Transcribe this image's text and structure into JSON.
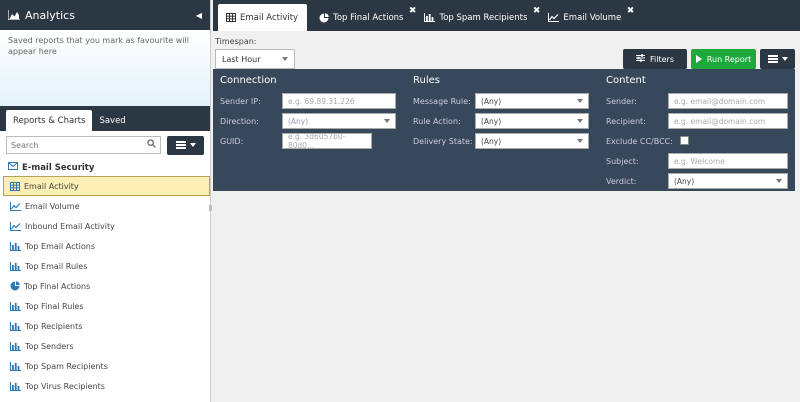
{
  "sidebar": {
    "title": "Analytics",
    "favourites_note": "Saved reports that you mark as favourite will appear here",
    "tabs": [
      {
        "label": "Reports & Charts",
        "active": true
      },
      {
        "label": "Saved",
        "active": false
      }
    ],
    "search_placeholder": "Search",
    "section_title": "E-mail Security",
    "items": [
      {
        "label": "Email Activity",
        "icon": "table-icon",
        "active": true
      },
      {
        "label": "Email Volume",
        "icon": "line-chart-icon"
      },
      {
        "label": "Inbound Email Activity",
        "icon": "line-chart-icon"
      },
      {
        "label": "Top Email Actions",
        "icon": "bar-chart-icon"
      },
      {
        "label": "Top Email Rules",
        "icon": "bar-chart-icon"
      },
      {
        "label": "Top Final Actions",
        "icon": "pie-chart-icon"
      },
      {
        "label": "Top Final Rules",
        "icon": "bar-chart-icon"
      },
      {
        "label": "Top Recipients",
        "icon": "bar-chart-icon"
      },
      {
        "label": "Top Senders",
        "icon": "bar-chart-icon"
      },
      {
        "label": "Top Spam Recipients",
        "icon": "bar-chart-icon"
      },
      {
        "label": "Top Virus Recipients",
        "icon": "bar-chart-icon"
      }
    ]
  },
  "tabs": [
    {
      "label": "Email Activity",
      "icon": "table-icon",
      "active": true,
      "closable": false
    },
    {
      "label": "Top Final Actions",
      "icon": "pie-chart-icon",
      "closable": true
    },
    {
      "label": "Top Spam Recipients",
      "icon": "bar-chart-icon",
      "closable": true
    },
    {
      "label": "Email Volume",
      "icon": "line-chart-icon",
      "closable": true
    }
  ],
  "toolbar": {
    "timespan_label": "Timespan:",
    "timespan_value": "Last Hour",
    "filters_label": "Filters",
    "run_label": "Run Report"
  },
  "filters": {
    "connection": {
      "title": "Connection",
      "sender_ip_label": "Sender IP:",
      "sender_ip_placeholder": "e.g. 69.89.31.226",
      "direction_label": "Direction:",
      "direction_value": "(Any)",
      "guid_label": "GUID:",
      "guid_placeholder": "e.g. 3d6057b0-80d0..."
    },
    "rules": {
      "title": "Rules",
      "message_rule_label": "Message Rule:",
      "message_rule_value": "(Any)",
      "rule_action_label": "Rule Action:",
      "rule_action_value": "(Any)",
      "delivery_state_label": "Delivery State:",
      "delivery_state_value": "(Any)"
    },
    "content": {
      "title": "Content",
      "sender_label": "Sender:",
      "sender_placeholder": "e.g. email@domain.com",
      "recipient_label": "Recipient:",
      "recipient_placeholder": "e.g. email@domain.com",
      "exclude_label": "Exclude CC/BCC:",
      "subject_label": "Subject:",
      "subject_placeholder": "e.g. Welcome",
      "verdict_label": "Verdict:",
      "verdict_value": "(Any)"
    }
  },
  "colors": {
    "dark_navy": "#2c3744",
    "filter_panel": "#37485a",
    "run_green": "#1fa83b",
    "active_item": "#fbefb3"
  }
}
